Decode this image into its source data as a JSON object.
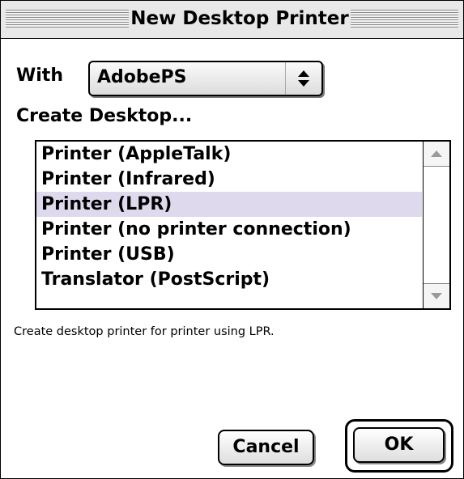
{
  "window": {
    "title": "New Desktop Printer"
  },
  "with_label": "With",
  "driver_popup": {
    "value": "AdobePS",
    "icon": "up-down-arrows-icon"
  },
  "create_label": "Create Desktop...",
  "printer_types": {
    "items": [
      {
        "label": "Printer (AppleTalk)",
        "selected": false
      },
      {
        "label": "Printer (Infrared)",
        "selected": false
      },
      {
        "label": "Printer (LPR)",
        "selected": true
      },
      {
        "label": "Printer (no printer connection)",
        "selected": false
      },
      {
        "label": "Printer (USB)",
        "selected": false
      },
      {
        "label": "Translator (PostScript)",
        "selected": false
      }
    ],
    "scroll_up_icon": "up-triangle-icon",
    "scroll_down_icon": "down-triangle-icon"
  },
  "description": "Create desktop printer for printer using LPR.",
  "buttons": {
    "cancel": "Cancel",
    "ok": "OK"
  },
  "colors": {
    "selection": "#ded9ec",
    "title_bar": "#e8e8e8"
  }
}
